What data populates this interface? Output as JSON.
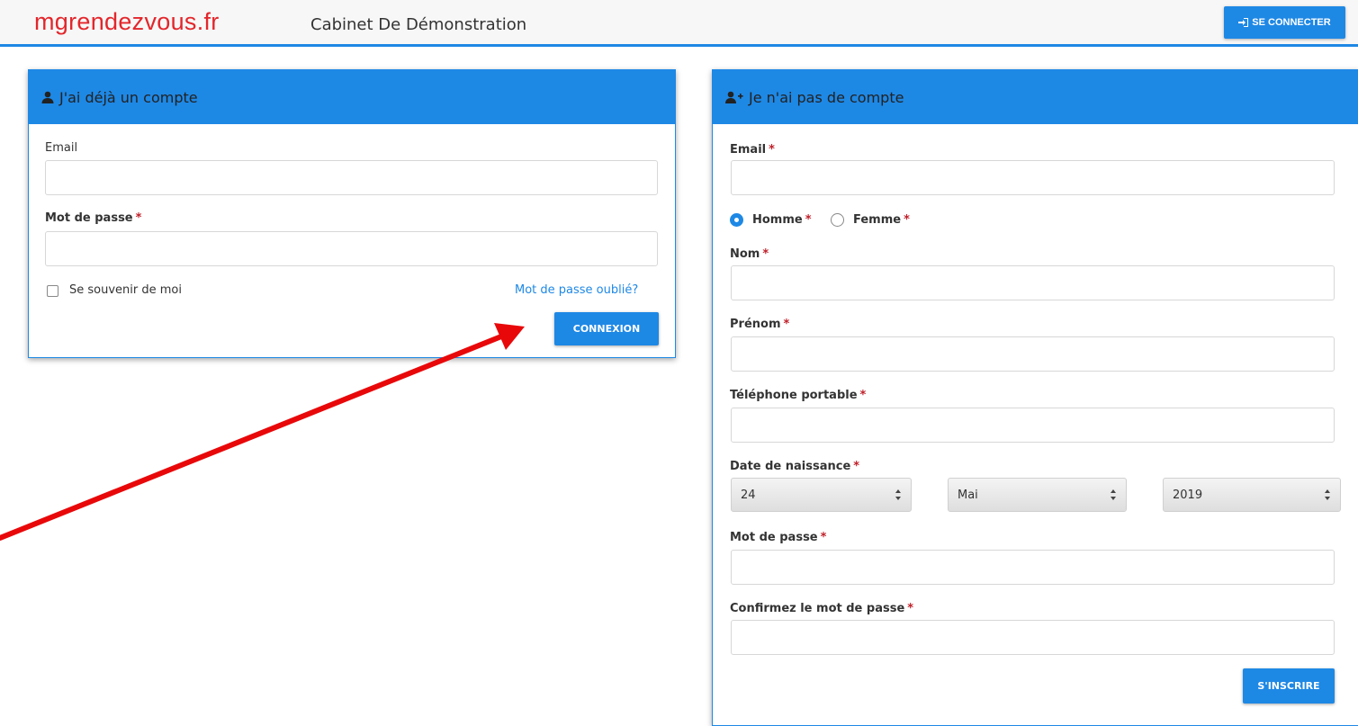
{
  "header": {
    "logo": "mgrendezvous.fr",
    "cabinet": "Cabinet De Démonstration",
    "connect_label": "SE CONNECTER"
  },
  "login": {
    "title": "J'ai déjà un compte",
    "email_label": "Email",
    "email_value": "",
    "password_label": "Mot de passe",
    "password_value": "",
    "required_mark": "*",
    "remember_label": "Se souvenir de moi",
    "forgot_label": "Mot de passe oublié?",
    "submit_label": "CONNEXION"
  },
  "signup": {
    "title": "Je n'ai pas de compte",
    "email_label": "Email",
    "gender_male": "Homme",
    "gender_female": "Femme",
    "selected_gender": "Homme",
    "nom_label": "Nom",
    "prenom_label": "Prénom",
    "phone_label": "Téléphone portable",
    "birth_label": "Date de naissance",
    "birth_day": "24",
    "birth_month": "Mai",
    "birth_year": "2019",
    "password_label": "Mot de passe",
    "confirm_label": "Confirmez le mot de passe",
    "submit_label": "S'INSCRIRE",
    "required_mark": "*"
  },
  "colors": {
    "accent": "#1e88e5",
    "logo": "#e3262b",
    "required": "#c0202a",
    "annotation_arrow": "#e8080a"
  },
  "icons": {
    "connect": "sign-in-icon",
    "login_panel": "user-icon",
    "signup_panel": "user-plus-icon"
  }
}
